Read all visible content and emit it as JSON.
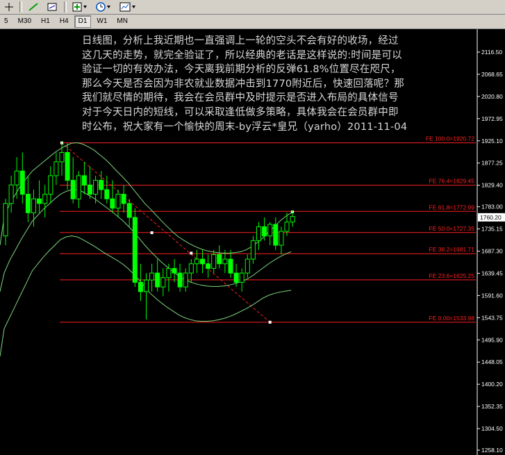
{
  "toolbar": {
    "icons": [
      "crosshair-icon",
      "arrow-cursor-icon",
      "zoom-icon",
      "add-indicator-icon",
      "clock-icon",
      "templates-icon"
    ]
  },
  "timeframes": {
    "items": [
      "5",
      "M30",
      "H1",
      "H4",
      "D1",
      "W1",
      "MN"
    ],
    "active": "D1"
  },
  "annotation": {
    "lines": [
      "日线图，分析上我近期也一直强调上一轮的空头不会有好的收场，经过",
      "这几天的走势，就完全验证了，所以经典的老话是这样说的:时间是可以",
      "验证一切的有效办法，今天离我前期分析的反弹61.8%位置尽在咫尺，",
      "那么今天是否会因为非农就业数据冲击到1770附近后，快速回落呢？那",
      "我们就尽情的期待，我会在会员群中及时提示是否进入布局的具体信号",
      "对于今天日内的短线，可以采取逢低做多策略，具体我会在会员群中即",
      "时公布，祝大家有一个愉快的周末-by浮云*皇兄（yarho）2011-11-04"
    ]
  },
  "price_axis": {
    "ticks": [
      "2116.50",
      "2068.65",
      "2020.80",
      "1972.95",
      "1925.10",
      "1877.25",
      "1829.40",
      "1783.00",
      "1735.15",
      "1687.30",
      "1639.45",
      "1591.60",
      "1543.75",
      "1495.90",
      "1448.05",
      "1400.20",
      "1352.35",
      "1304.50",
      "1258.10"
    ],
    "current_price": "1760.20",
    "colors": {
      "axis_bg": "#000000",
      "text": "#ffffff",
      "current_bg": "#ffffff",
      "current_text": "#000000"
    }
  },
  "fibo": {
    "levels": [
      {
        "label": "FE 100.0=1920.72",
        "price": 1920.72
      },
      {
        "label": "FE 76.4=1829.45",
        "price": 1829.45
      },
      {
        "label": "FE 61.8=1772.99",
        "price": 1772.99
      },
      {
        "label": "FE 50.0=1727.35",
        "price": 1727.35
      },
      {
        "label": "FE 38.2=1681.71",
        "price": 1681.71
      },
      {
        "label": "FE 23.6=1625.25",
        "price": 1625.25
      },
      {
        "label": "FE 0.00=1533.98",
        "price": 1533.98
      }
    ],
    "color": "#ff2020"
  },
  "chart_data": {
    "type": "candlestick",
    "symbol_timeframe": "D1",
    "ylim": [
      1258.1,
      2140
    ],
    "bull_color": "#00ff00",
    "bear_color": "#00ff00",
    "band_color": "#7fd77f",
    "candles": [
      [
        1720,
        1800,
        1700,
        1790
      ],
      [
        1790,
        1850,
        1770,
        1830
      ],
      [
        1830,
        1890,
        1800,
        1860
      ],
      [
        1860,
        1900,
        1790,
        1810
      ],
      [
        1810,
        1850,
        1750,
        1770
      ],
      [
        1770,
        1820,
        1740,
        1800
      ],
      [
        1800,
        1840,
        1770,
        1790
      ],
      [
        1790,
        1830,
        1760,
        1810
      ],
      [
        1810,
        1870,
        1790,
        1850
      ],
      [
        1850,
        1900,
        1830,
        1880
      ],
      [
        1880,
        1925,
        1850,
        1900
      ],
      [
        1900,
        1920,
        1820,
        1840
      ],
      [
        1840,
        1890,
        1790,
        1800
      ],
      [
        1800,
        1860,
        1780,
        1850
      ],
      [
        1850,
        1880,
        1810,
        1830
      ],
      [
        1830,
        1870,
        1800,
        1810
      ],
      [
        1810,
        1850,
        1790,
        1840
      ],
      [
        1840,
        1860,
        1800,
        1820
      ],
      [
        1820,
        1850,
        1790,
        1800
      ],
      [
        1800,
        1840,
        1770,
        1780
      ],
      [
        1780,
        1820,
        1760,
        1810
      ],
      [
        1810,
        1830,
        1770,
        1790
      ],
      [
        1790,
        1800,
        1740,
        1760
      ],
      [
        1760,
        1780,
        1610,
        1620
      ],
      [
        1620,
        1660,
        1580,
        1600
      ],
      [
        1600,
        1640,
        1540,
        1625
      ],
      [
        1625,
        1660,
        1600,
        1640
      ],
      [
        1640,
        1670,
        1600,
        1610
      ],
      [
        1610,
        1650,
        1590,
        1630
      ],
      [
        1630,
        1660,
        1600,
        1650
      ],
      [
        1650,
        1670,
        1620,
        1640
      ],
      [
        1640,
        1660,
        1600,
        1610
      ],
      [
        1610,
        1650,
        1600,
        1640
      ],
      [
        1640,
        1670,
        1620,
        1660
      ],
      [
        1660,
        1690,
        1640,
        1670
      ],
      [
        1670,
        1690,
        1640,
        1660
      ],
      [
        1660,
        1680,
        1630,
        1650
      ],
      [
        1650,
        1690,
        1640,
        1680
      ],
      [
        1680,
        1700,
        1650,
        1660
      ],
      [
        1660,
        1690,
        1640,
        1670
      ],
      [
        1670,
        1690,
        1630,
        1640
      ],
      [
        1640,
        1660,
        1610,
        1620
      ],
      [
        1620,
        1650,
        1600,
        1640
      ],
      [
        1640,
        1680,
        1630,
        1670
      ],
      [
        1670,
        1720,
        1660,
        1710
      ],
      [
        1710,
        1750,
        1690,
        1740
      ],
      [
        1740,
        1760,
        1710,
        1720
      ],
      [
        1720,
        1750,
        1700,
        1745
      ],
      [
        1745,
        1760,
        1690,
        1700
      ],
      [
        1700,
        1740,
        1680,
        1730
      ],
      [
        1730,
        1770,
        1720,
        1750
      ],
      [
        1750,
        1775,
        1740,
        1762
      ]
    ],
    "upper_band": [
      1760,
      1790,
      1810,
      1830,
      1845,
      1860,
      1870,
      1880,
      1890,
      1900,
      1908,
      1915,
      1920,
      1921,
      1918,
      1912,
      1905,
      1895,
      1885,
      1873,
      1860,
      1848,
      1835,
      1820,
      1805,
      1790,
      1778,
      1765,
      1752,
      1740,
      1728,
      1718,
      1710,
      1703,
      1697,
      1692,
      1688,
      1686,
      1684,
      1683,
      1683,
      1684,
      1686,
      1690,
      1697,
      1706,
      1716,
      1728,
      1740,
      1752,
      1762,
      1770
    ],
    "lower_band": [
      1520,
      1545,
      1570,
      1595,
      1620,
      1645,
      1660,
      1675,
      1688,
      1700,
      1712,
      1718,
      1720,
      1718,
      1712,
      1705,
      1698,
      1690,
      1682,
      1675,
      1668,
      1660,
      1650,
      1638,
      1625,
      1610,
      1596,
      1585,
      1575,
      1566,
      1558,
      1550,
      1544,
      1540,
      1537,
      1536,
      1536,
      1537,
      1539,
      1542,
      1546,
      1551,
      1557,
      1563,
      1570,
      1578,
      1586,
      1592,
      1596,
      1599,
      1601,
      1603
    ],
    "middle_band": [
      1640,
      1668,
      1690,
      1712,
      1732,
      1752,
      1765,
      1778,
      1789,
      1800,
      1810,
      1816,
      1820,
      1820,
      1815,
      1808,
      1801,
      1792,
      1783,
      1774,
      1764,
      1754,
      1742,
      1729,
      1715,
      1700,
      1687,
      1675,
      1663,
      1653,
      1643,
      1634,
      1627,
      1621,
      1617,
      1614,
      1612,
      1611,
      1611,
      1612,
      1614,
      1617,
      1621,
      1626,
      1633,
      1642,
      1651,
      1660,
      1668,
      1675,
      1681,
      1686
    ],
    "trendline": {
      "from_index": 10,
      "from_price": 1920.72,
      "to_index": 47,
      "to_price": 1533.98
    }
  }
}
